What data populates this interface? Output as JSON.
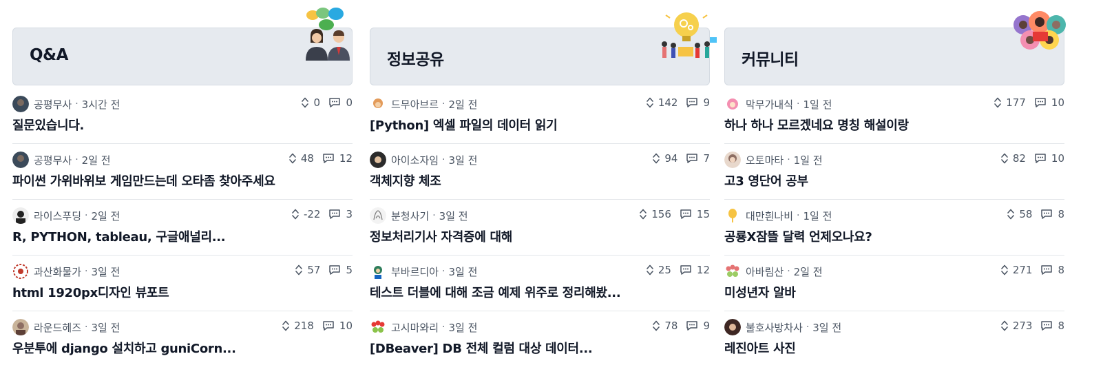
{
  "columns": [
    {
      "title": "Q&A",
      "illustration": "people-chat-icon",
      "posts": [
        {
          "author": "공평무사",
          "time": "3시간 전",
          "votes": "0",
          "comments": "0",
          "title": "질문있습니다.",
          "avatar_color": "#3b4a5a"
        },
        {
          "author": "공평무사",
          "time": "2일 전",
          "votes": "48",
          "comments": "12",
          "title": "파이썬 가위바위보 게임만드는데 오타좀 찾아주세요",
          "avatar_color": "#3b4a5a"
        },
        {
          "author": "라이스푸딩",
          "time": "2일 전",
          "votes": "-22",
          "comments": "3",
          "title": "R, PYTHON, tableau, 구글애널리...",
          "avatar_color": "#222222"
        },
        {
          "author": "과산화물가",
          "time": "3일 전",
          "votes": "57",
          "comments": "5",
          "title": "html 1920px디자인 뷰포트",
          "avatar_color": "#c0392b"
        },
        {
          "author": "라운드헤즈",
          "time": "3일 전",
          "votes": "218",
          "comments": "10",
          "title": "우분투에 django 설치하고 guniCorn...",
          "avatar_color": "#8d6e63"
        }
      ]
    },
    {
      "title": "정보공유",
      "illustration": "lightbulb-team-icon",
      "posts": [
        {
          "author": "드무아브르",
          "time": "2일 전",
          "votes": "142",
          "comments": "9",
          "title": "[Python] 엑셀 파일의 데이터 읽기",
          "avatar_color": "#e39b5a"
        },
        {
          "author": "아이소자임",
          "time": "3일 전",
          "votes": "94",
          "comments": "7",
          "title": "객체지향 체조",
          "avatar_color": "#2b2b2b"
        },
        {
          "author": "분청사기",
          "time": "3일 전",
          "votes": "156",
          "comments": "15",
          "title": "정보처리기사 자격증에 대해",
          "avatar_color": "#f3f3f3"
        },
        {
          "author": "부바르디아",
          "time": "3일 전",
          "votes": "25",
          "comments": "12",
          "title": "테스트 더블에 대해 조금 예제 위주로 정리해봤...",
          "avatar_color": "#2e7d5b"
        },
        {
          "author": "고시마와리",
          "time": "3일 전",
          "votes": "78",
          "comments": "9",
          "title": "[DBeaver] DB 전체 컬럼 대상 데이터...",
          "avatar_color": "#8bc34a"
        }
      ]
    },
    {
      "title": "커뮤니티",
      "illustration": "community-people-icon",
      "posts": [
        {
          "author": "막무가내식",
          "time": "1일 전",
          "votes": "177",
          "comments": "10",
          "title": "하나 하나 모르겠네요 명칭 해설이랑",
          "avatar_color": "#f48fb1"
        },
        {
          "author": "오토마타",
          "time": "1일 전",
          "votes": "82",
          "comments": "10",
          "title": "고3 영단어 공부",
          "avatar_color": "#d7b8a8"
        },
        {
          "author": "대만흰나비",
          "time": "1일 전",
          "votes": "58",
          "comments": "8",
          "title": "공룡X잠뜰 달력 언제오나요?",
          "avatar_color": "#f6c343"
        },
        {
          "author": "아바림산",
          "time": "2일 전",
          "votes": "271",
          "comments": "8",
          "title": "미성년자 알바",
          "avatar_color": "#9ccc65"
        },
        {
          "author": "불호사방차사",
          "time": "3일 전",
          "votes": "273",
          "comments": "8",
          "title": "레진아트 사진",
          "avatar_color": "#3e2723"
        }
      ]
    }
  ],
  "icons": {
    "vote": "up-down-chevron-icon",
    "comment": "comment-bubble-icon"
  },
  "separator": "·"
}
